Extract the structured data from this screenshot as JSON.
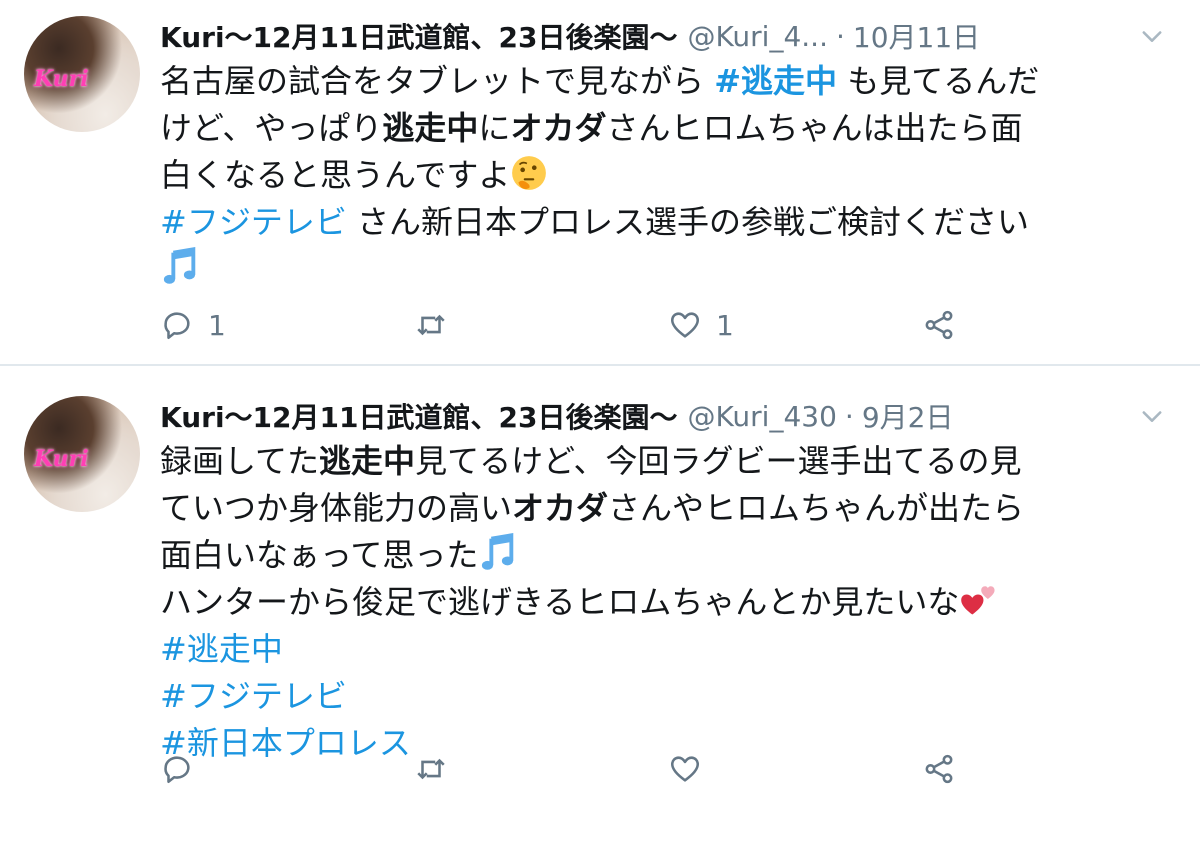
{
  "tweets": [
    {
      "name": "Kuri～12月11日武道館、23日後楽園～",
      "handle": "@Kuri_4...",
      "separator": "·",
      "date": "10月11日",
      "avatar_text": "Kuri",
      "lines": [
        [
          "名古屋の試合をタブレットで見ながら ",
          "#逃走中",
          " も見てるんだ"
        ],
        [
          "けど、やっぱり",
          "逃走中",
          "に",
          "オカダ",
          "さんヒロムちゃんは出たら面"
        ],
        [
          "白くなると思うんですよ"
        ],
        [
          "#フジテレビ",
          " さん新日本プロレス選手の参戦ご検討ください"
        ]
      ],
      "reply_count": "1",
      "retweet_count": "",
      "like_count": "1"
    },
    {
      "name": "Kuri～12月11日武道館、23日後楽園～",
      "handle": "@Kuri_430",
      "separator": "·",
      "date": "9月2日",
      "avatar_text": "Kuri",
      "lines": [
        [
          "録画してた",
          "逃走中",
          "見てるけど、今回ラグビー選手出てるの見"
        ],
        [
          "ていつか身体能力の高い",
          "オカダ",
          "さんやヒロムちゃんが出たら"
        ],
        [
          "面白いなぁって思った"
        ],
        [
          "ハンターから俊足で逃げきるヒロムちゃんとか見たいな"
        ],
        [
          "#逃走中"
        ],
        [
          "#フジテレビ"
        ],
        [
          "#新日本プロレス"
        ]
      ],
      "reply_count": "",
      "retweet_count": "",
      "like_count": ""
    }
  ],
  "icons": [
    "reply-icon",
    "retweet-icon",
    "like-icon",
    "share-icon",
    "chevron-down-icon",
    "thinking-face-emoji",
    "music-note-emoji",
    "two-hearts-emoji"
  ],
  "colors": {
    "link": "#1b95e0",
    "text": "#14171a",
    "secondary": "#657786",
    "divider": "#e1e8ed"
  }
}
